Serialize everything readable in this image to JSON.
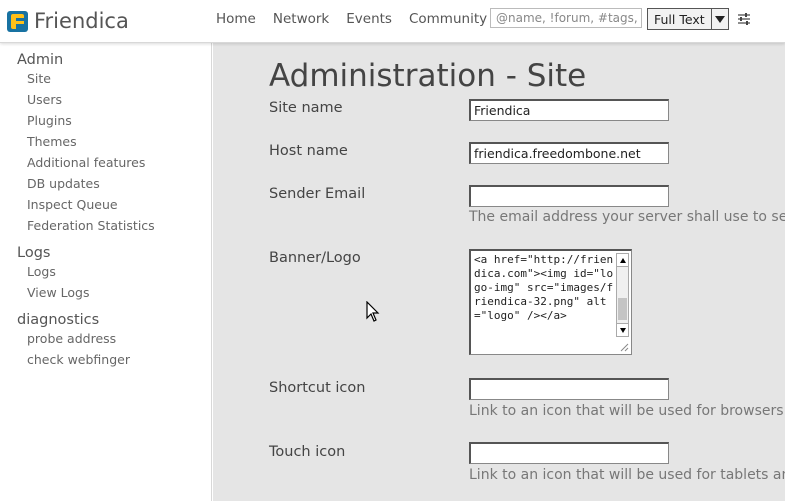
{
  "brand": {
    "name": "Friendica"
  },
  "nav": [
    "Home",
    "Network",
    "Events",
    "Community"
  ],
  "search": {
    "placeholder": "@name, !forum, #tags, content",
    "type": "Full Text"
  },
  "sidebar": {
    "groups": [
      {
        "title": "Admin",
        "items": [
          "Site",
          "Users",
          "Plugins",
          "Themes",
          "Additional features",
          "DB updates",
          "Inspect Queue",
          "Federation Statistics"
        ]
      },
      {
        "title": "Logs",
        "items": [
          "Logs",
          "View Logs"
        ]
      },
      {
        "title": "diagnostics",
        "items": [
          "probe address",
          "check webfinger"
        ]
      }
    ]
  },
  "main": {
    "title": "Administration - Site",
    "fields": {
      "site_name": {
        "label": "Site name",
        "value": "Friendica"
      },
      "host_name": {
        "label": "Host name",
        "value": "friendica.freedombone.net"
      },
      "sender_email": {
        "label": "Sender Email",
        "value": "",
        "help": "The email address your server shall use to send notification emails from."
      },
      "banner": {
        "label": "Banner/Logo",
        "value": "<a href=\"http://friendica.com\"><img id=\"logo-img\" src=\"images/friendica-32.png\" alt=\"logo\" /></a>"
      },
      "shortcut_icon": {
        "label": "Shortcut icon",
        "value": "",
        "help": "Link to an icon that will be used for browsers."
      },
      "touch_icon": {
        "label": "Touch icon",
        "value": "",
        "help": "Link to an icon that will be used for tablets and mobiles."
      }
    }
  },
  "colors": {
    "logo_blue": "#1872a2",
    "logo_yellow": "#ffc019",
    "content_bg": "#e5e5e5"
  }
}
